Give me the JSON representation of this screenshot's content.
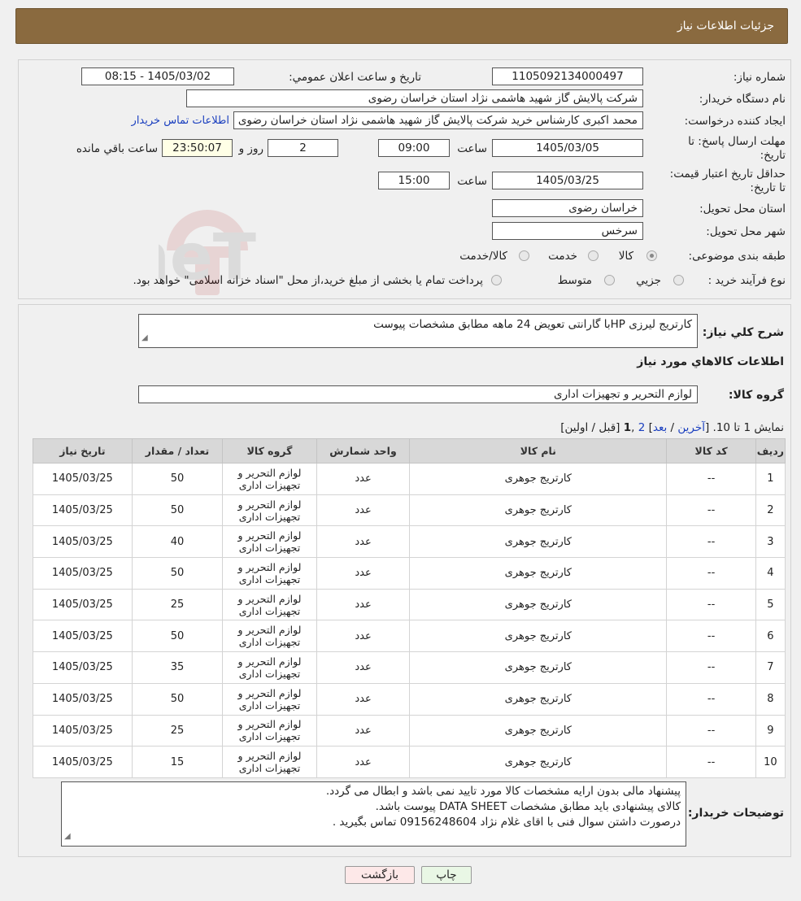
{
  "header": {
    "title": "جزئیات اطلاعات نیاز"
  },
  "watermark": {
    "text": "AriaTender.neT"
  },
  "info": {
    "need_number_label": "شماره نیاز:",
    "need_number": "1105092134000497",
    "announce_label": "تاریخ و ساعت اعلان عمومي:",
    "announce_value": "1405/03/02 - 08:15",
    "buyer_org_label": "نام دستگاه خريدار:",
    "buyer_org": "شرکت پالایش گاز شهید هاشمی نژاد   استان خراسان رضوی",
    "creator_label": "ايجاد کننده درخواست:",
    "creator": "محمد اکبری کارشناس خرید شرکت پالایش گاز شهید هاشمی نژاد   استان خراسان رضوی",
    "contact_link": "اطلاعات تماس خريدار",
    "deadline_label": "مهلت ارسال پاسخ: تا تاريخ:",
    "deadline_date": "1405/03/05",
    "time_label": "ساعت",
    "deadline_time": "09:00",
    "days_value": "2",
    "days_label": "روز و",
    "remaining_time": "23:50:07",
    "remaining_label": "ساعت باقي مانده",
    "validity_label": "حداقل تاريخ اعتبار قيمت: تا تاريخ:",
    "validity_date": "1405/03/25",
    "validity_time": "15:00",
    "province_label": "استان محل تحويل:",
    "province": "خراسان رضوی",
    "city_label": "شهر محل تحويل:",
    "city": "سرخس",
    "category_label": "طبقه بندی موضوعی:",
    "category_options": [
      "کالا",
      "خدمت",
      "کالا/خدمت"
    ],
    "process_label": "نوع فرآيند خريد :",
    "process_options": [
      "جزيي",
      "متوسط"
    ],
    "payment_note": "پرداخت تمام یا بخشی از مبلغ خرید،از محل \"اسناد خزانه اسلامی\" خواهد بود."
  },
  "details": {
    "description_label": "شرح کلي نياز:",
    "description": "کارتریج لیرزی HPبا گارانتی تعویض 24 ماهه مطابق مشخصات پیوست",
    "goods_info_title": "اطلاعات کالاهاي مورد نياز",
    "goods_group_label": "گروه کالا:",
    "goods_group": "لوازم التحرير و تجهيزات اداری",
    "pagination": {
      "prefix": "نمایش 1 تا 10. [",
      "last": "آخرين",
      "sep1": " / ",
      "next": "بعد",
      "sep2": "] ",
      "page2": "2",
      "sep3": " ,",
      "page1": "1",
      "suffix": " [قبل / اولين]"
    },
    "table": {
      "headers": [
        "رديف",
        "کد کالا",
        "نام کالا",
        "واحد شمارش",
        "گروه کالا",
        "تعداد / مقدار",
        "تاريخ نياز"
      ],
      "rows": [
        {
          "idx": "1",
          "code": "--",
          "name": "کارتریج جوهری",
          "unit": "عدد",
          "group": "لوازم التحرير و تجهيزات اداری",
          "qty": "50",
          "date": "1405/03/25"
        },
        {
          "idx": "2",
          "code": "--",
          "name": "کارتریج جوهری",
          "unit": "عدد",
          "group": "لوازم التحرير و تجهيزات اداری",
          "qty": "50",
          "date": "1405/03/25"
        },
        {
          "idx": "3",
          "code": "--",
          "name": "کارتریج جوهری",
          "unit": "عدد",
          "group": "لوازم التحرير و تجهيزات اداری",
          "qty": "40",
          "date": "1405/03/25"
        },
        {
          "idx": "4",
          "code": "--",
          "name": "کارتریج جوهری",
          "unit": "عدد",
          "group": "لوازم التحرير و تجهيزات اداری",
          "qty": "50",
          "date": "1405/03/25"
        },
        {
          "idx": "5",
          "code": "--",
          "name": "کارتریج جوهری",
          "unit": "عدد",
          "group": "لوازم التحرير و تجهيزات اداری",
          "qty": "25",
          "date": "1405/03/25"
        },
        {
          "idx": "6",
          "code": "--",
          "name": "کارتریج جوهری",
          "unit": "عدد",
          "group": "لوازم التحرير و تجهيزات اداری",
          "qty": "50",
          "date": "1405/03/25"
        },
        {
          "idx": "7",
          "code": "--",
          "name": "کارتریج جوهری",
          "unit": "عدد",
          "group": "لوازم التحرير و تجهيزات اداری",
          "qty": "35",
          "date": "1405/03/25"
        },
        {
          "idx": "8",
          "code": "--",
          "name": "کارتریج جوهری",
          "unit": "عدد",
          "group": "لوازم التحرير و تجهيزات اداری",
          "qty": "50",
          "date": "1405/03/25"
        },
        {
          "idx": "9",
          "code": "--",
          "name": "کارتریج جوهری",
          "unit": "عدد",
          "group": "لوازم التحرير و تجهيزات اداری",
          "qty": "25",
          "date": "1405/03/25"
        },
        {
          "idx": "10",
          "code": "--",
          "name": "کارتریج جوهری",
          "unit": "عدد",
          "group": "لوازم التحرير و تجهيزات اداری",
          "qty": "15",
          "date": "1405/03/25"
        }
      ]
    },
    "buyer_notes_label": "توضيحات خريدار:",
    "buyer_notes": [
      "پیشنهاد مالی بدون ارایه مشخصات کالا مورد تایید نمی باشد و ابطال می گردد.",
      "کالای پیشنهادی باید مطابق مشخصات DATA SHEET پیوست باشد.",
      "درصورت داشتن سوال فنی با اقای غلام نژاد 09156248604 تماس بگیرید ."
    ]
  },
  "buttons": {
    "print": "چاپ",
    "back": "بازگشت"
  }
}
